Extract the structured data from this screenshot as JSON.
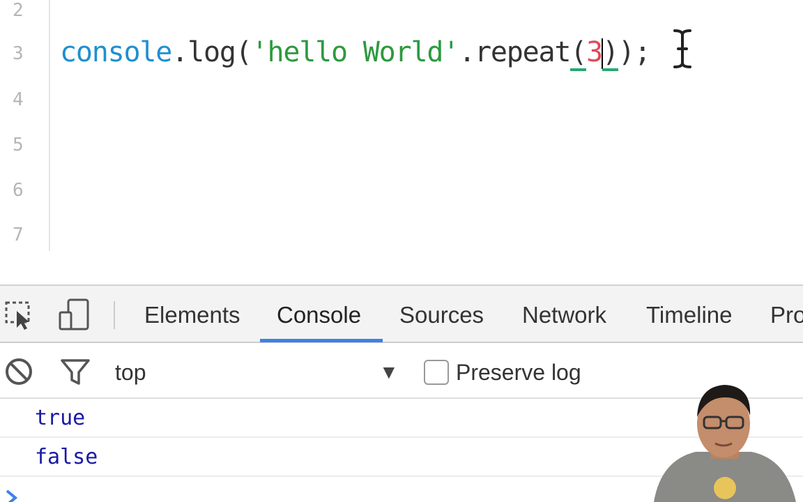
{
  "editor": {
    "line_numbers": [
      "2",
      "3",
      "4",
      "5",
      "6",
      "7"
    ],
    "code": {
      "object": "console",
      "dot1": ".",
      "method": "log",
      "open_paren": "(",
      "string": "'hello World'",
      "dot2": ".",
      "method2": "repeat",
      "open_paren2": "(",
      "number": "3",
      "close_paren2": ")",
      "close_paren": ")",
      "semicolon": ";"
    }
  },
  "devtools": {
    "tabs": [
      "Elements",
      "Console",
      "Sources",
      "Network",
      "Timeline",
      "Pro"
    ],
    "active_tab": "Console",
    "console_toolbar": {
      "context": "top",
      "preserve_log_label": "Preserve log",
      "preserve_log_checked": false
    },
    "messages": [
      "true",
      "false"
    ]
  },
  "colors": {
    "accent_tab_underline": "#3b82e8",
    "console_value_blue": "#1a1aa6",
    "code_keyword_blue": "#1f8fd0",
    "code_string_green": "#2c9a3f",
    "code_number_red": "#e04a5c"
  },
  "icons": [
    "inspect-element-icon",
    "device-mode-icon",
    "clear-console-icon",
    "filter-icon",
    "dropdown-arrow-icon",
    "console-prompt-icon",
    "text-cursor-icon"
  ]
}
